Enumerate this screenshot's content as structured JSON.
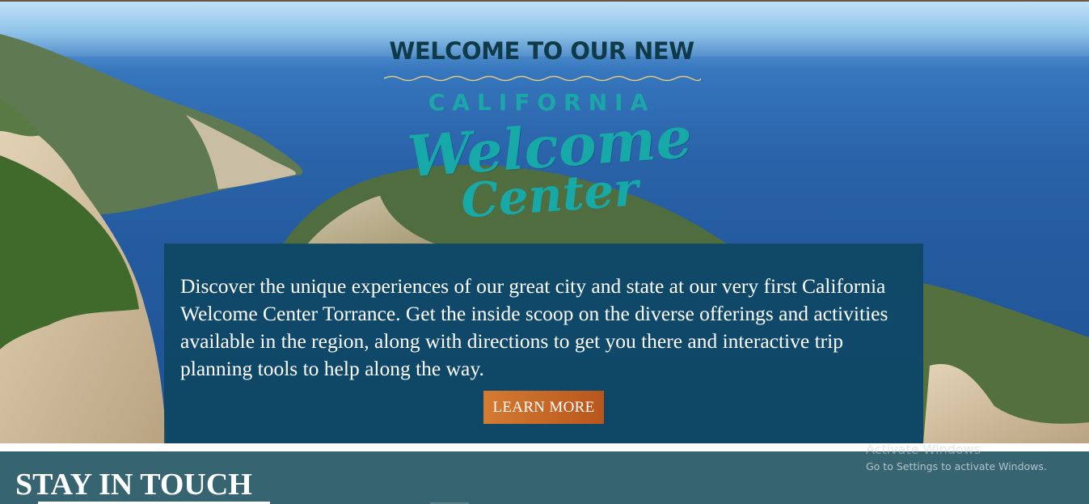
{
  "hero": {
    "logo": {
      "line1": "WELCOME TO OUR NEW",
      "line2": "CALIFORNIA",
      "line3": "Welcome",
      "line4": "Center"
    },
    "description": "Discover the unique experiences of our great city and state at our very first California Welcome Center Torrance. Get the inside scoop on the diverse offerings and activities available in the region, along with directions to get you there and interactive trip planning tools to help along the way.",
    "button_label": "LEARN MORE"
  },
  "stay_in_touch": {
    "title": "STAY IN TOUCH"
  },
  "windows_watermark": {
    "title": "Activate Windows",
    "subtitle": "Go to Settings to activate Windows."
  },
  "colors": {
    "panel": "#0d465f",
    "button": "#c4682a",
    "section_bg": "#376471",
    "logo_dark": "#0f3a4a",
    "logo_teal": "#16a9a7"
  }
}
